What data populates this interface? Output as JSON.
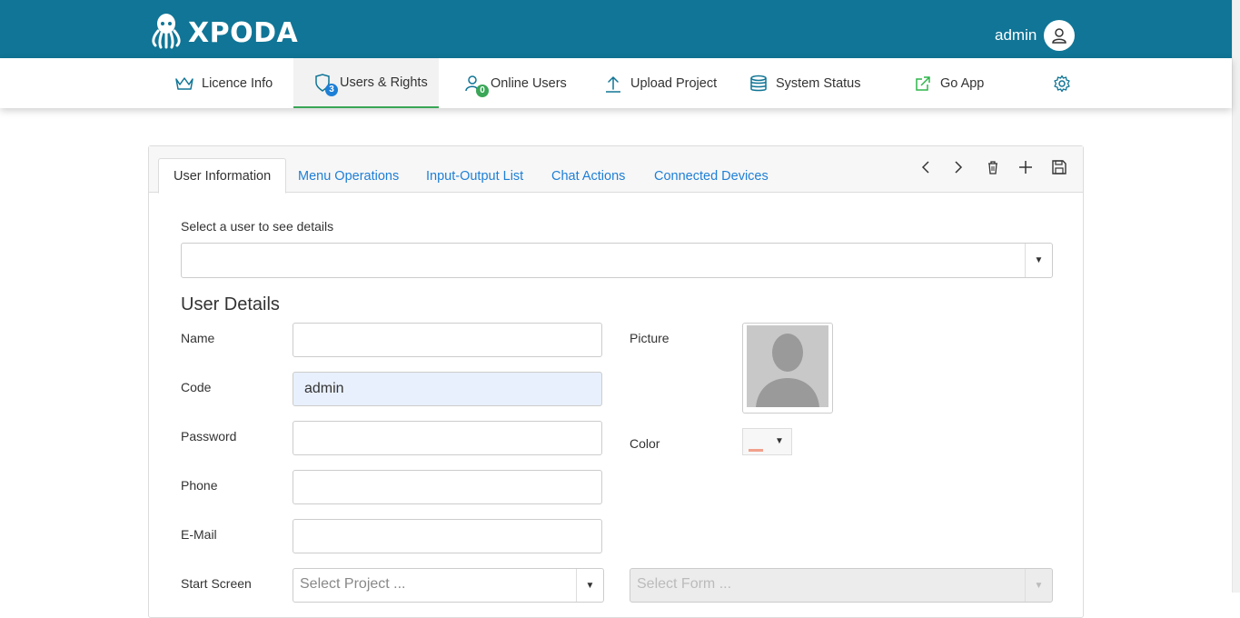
{
  "app": {
    "brand": "XPODA",
    "user": "admin"
  },
  "nav": {
    "licence": "Licence Info",
    "users": "Users & Rights",
    "users_badge": "3",
    "online": "Online Users",
    "online_badge": "0",
    "upload": "Upload Project",
    "status": "System Status",
    "goapp": "Go App"
  },
  "tabs": {
    "user_info": "User Information",
    "menu_ops": "Menu Operations",
    "io_list": "Input-Output List",
    "chat": "Chat Actions",
    "devices": "Connected Devices"
  },
  "form": {
    "select_user_label": "Select a user to see details",
    "section_title": "User Details",
    "name_label": "Name",
    "name_value": "",
    "code_label": "Code",
    "code_value": "admin",
    "password_label": "Password",
    "password_value": "",
    "phone_label": "Phone",
    "phone_value": "",
    "email_label": "E-Mail",
    "email_value": "",
    "picture_label": "Picture",
    "color_label": "Color",
    "start_screen_label": "Start Screen",
    "select_project_placeholder": "Select Project ...",
    "select_form_placeholder": "Select Form ..."
  },
  "colors": {
    "header": "#107596",
    "tab_link": "#1e7fd6",
    "active_underline": "#3aa657",
    "badge_users": "#1e7fd6",
    "badge_online": "#3aa657",
    "go_app_icon": "#2fb54a",
    "color_swatch": "#f2a08c"
  }
}
